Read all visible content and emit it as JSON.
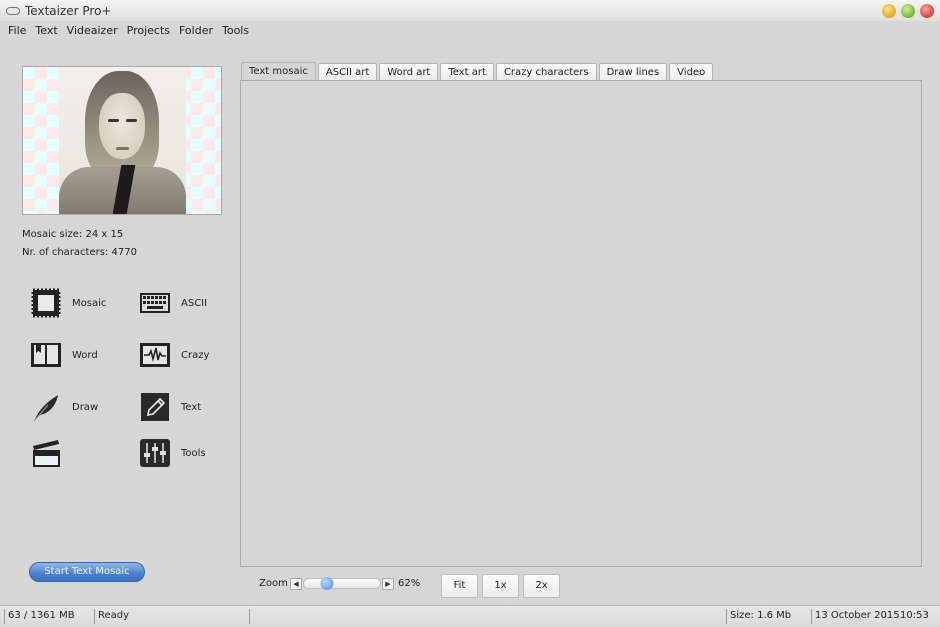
{
  "window": {
    "title": "Textaizer Pro+",
    "controls": [
      "minimize",
      "maximize",
      "close"
    ]
  },
  "menu": [
    "File",
    "Text",
    "Videaizer",
    "Projects",
    "Folder",
    "Tools"
  ],
  "left_panel": {
    "mosaic_size": "Mosaic size: 24 x 15",
    "nr_characters": "Nr. of characters: 4770",
    "tools": [
      {
        "label": "Mosaic",
        "icon": "stamp-frame-icon"
      },
      {
        "label": "ASCII",
        "icon": "keyboard-icon"
      },
      {
        "label": "Word",
        "icon": "open-book-icon"
      },
      {
        "label": "Crazy",
        "icon": "waveform-icon"
      },
      {
        "label": "Draw",
        "icon": "feather-icon"
      },
      {
        "label": "Text",
        "icon": "pencil-icon"
      },
      {
        "label": "",
        "icon": "clapperboard-icon"
      },
      {
        "label": "Tools",
        "icon": "sliders-icon"
      }
    ],
    "start_button": "Start Text Mosaic"
  },
  "tabs": [
    {
      "label": "Text mosaic",
      "active": true
    },
    {
      "label": "ASCII art",
      "active": false
    },
    {
      "label": "Word art",
      "active": false
    },
    {
      "label": "Text art",
      "active": false
    },
    {
      "label": "Crazy characters",
      "active": false
    },
    {
      "label": "Draw lines",
      "active": false
    },
    {
      "label": "Video",
      "active": false
    }
  ],
  "zoom": {
    "label": "Zoom",
    "value_percent": 62,
    "value_text": "62%",
    "slider_fraction": 0.3,
    "buttons": [
      "Fit",
      "1x",
      "2x"
    ]
  },
  "status": {
    "memory": "63 / 1361 MB",
    "state": "Ready",
    "size": "Size: 1.6 Mb",
    "date": "13 October 2015",
    "time": "10:53"
  }
}
